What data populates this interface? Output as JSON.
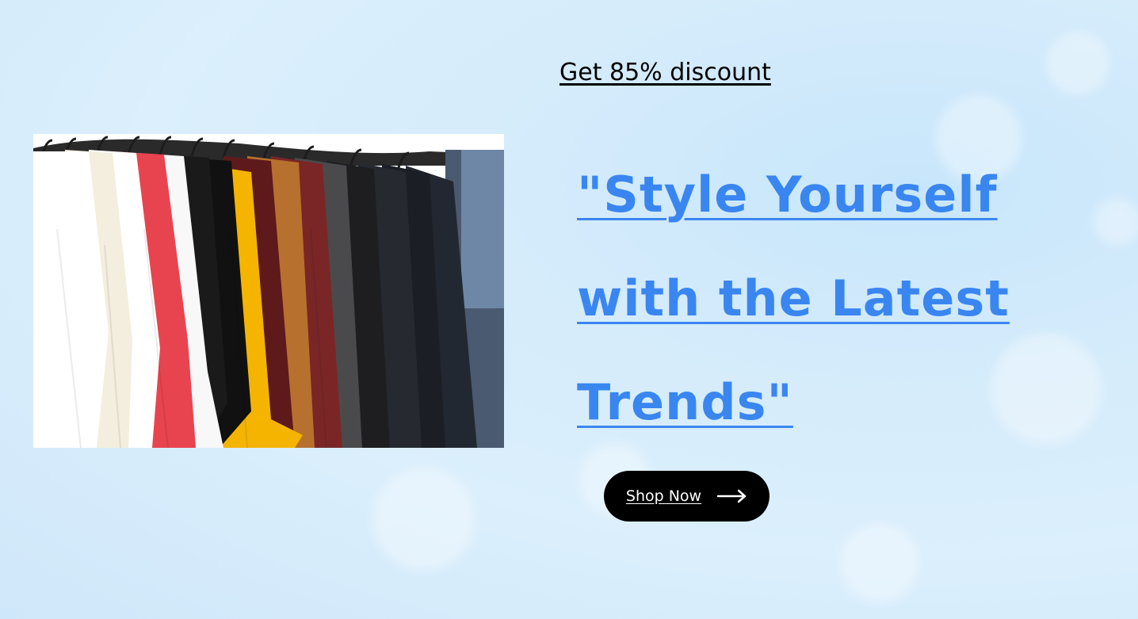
{
  "promo": {
    "discount_link": "Get 85% discount",
    "headline": "\"Style Yourself with the Latest Trends\"",
    "cta_label": "Shop Now",
    "cta_icon": "arrow-right-icon"
  },
  "image": {
    "subject": "clothes-rack-with-t-shirts"
  },
  "colors": {
    "headline": "#3a86f0",
    "button_bg": "#000000",
    "button_text": "#ffffff",
    "background": "#d6ecfb"
  }
}
